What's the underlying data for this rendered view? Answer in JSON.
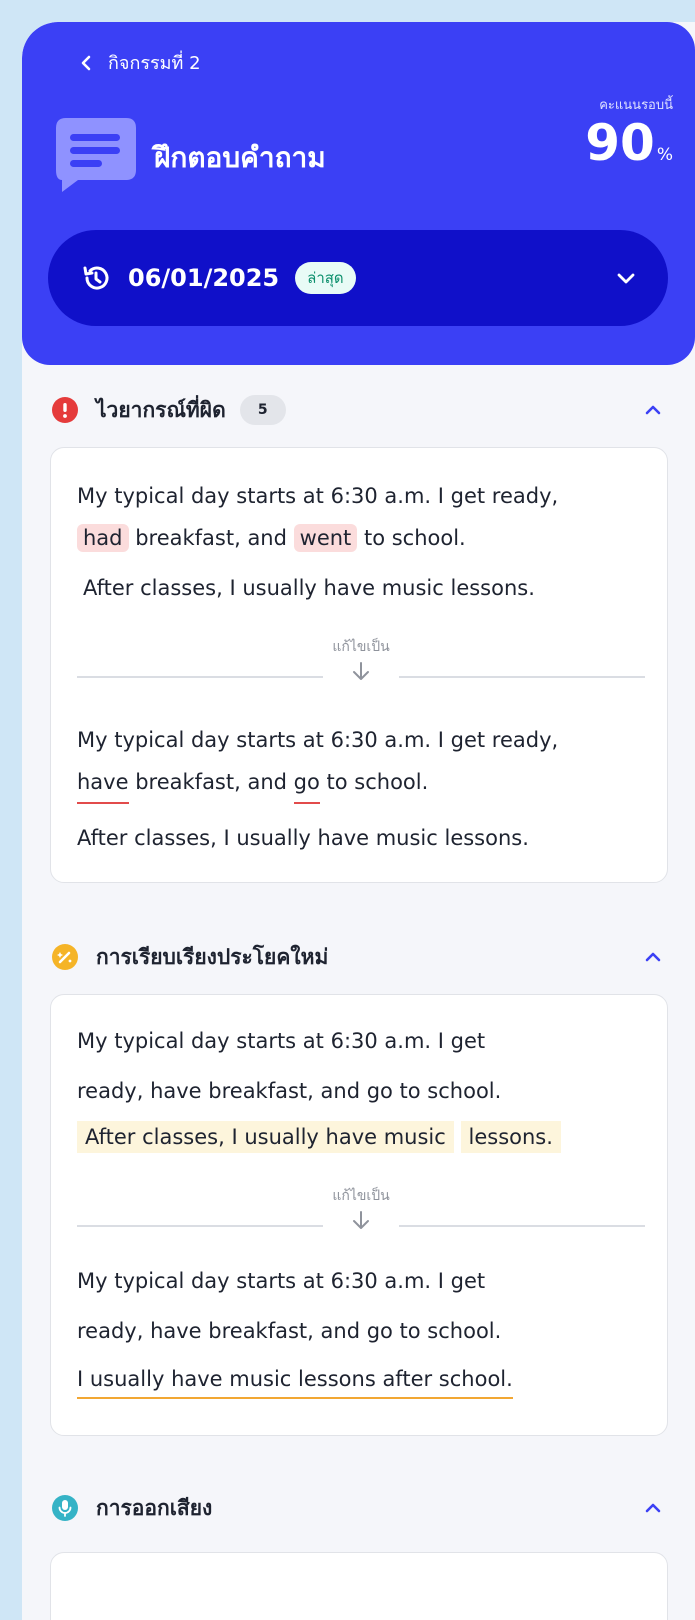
{
  "header": {
    "back_label": "กิจกรรมที่ 2",
    "title": "ฝึกตอบคำถาม",
    "score_label": "คะแนนรอบนี้",
    "score_value": "90",
    "score_unit": "%",
    "date": "06/01/2025",
    "latest_badge": "ล่าสุด"
  },
  "colors": {
    "header_bg": "#3b40f5",
    "date_bar_bg": "#1010c9",
    "grammar_icon": "#e53b3b",
    "rephrase_icon": "#f5b427",
    "pronunciation_icon": "#35b3c6",
    "accent_chevron": "#3b40f5"
  },
  "grammar": {
    "title": "ไวยากรณ์ที่ผิด",
    "count": "5",
    "icon": "exclamation-icon",
    "original": {
      "line1": "My typical day starts at 6:30 a.m. I get ready,",
      "err1": "had",
      "mid": "breakfast, and",
      "err2": "went",
      "end": "to school.",
      "line3": "After classes,  I usually have music lessons."
    },
    "divider": "แก้ไขเป็น",
    "corrected": {
      "line1": "My typical day starts at 6:30 a.m. I get ready,",
      "fix1": "have",
      "mid": "breakfast, and",
      "fix2": "go",
      "end": "to school.",
      "line3": "After classes, I usually have music lessons."
    }
  },
  "rephrase": {
    "title": "การเรียบเรียงประโยคใหม่",
    "icon": "magic-wand-icon",
    "original": {
      "line1": "My typical day starts at 6:30 a.m. I get",
      "line2": "ready, have breakfast, and go to school.",
      "hl1": "After classes, I usually have music",
      "hl2": "lessons."
    },
    "divider": "แก้ไขเป็น",
    "corrected": {
      "line1": "My typical day starts at 6:30 a.m. I get",
      "line2": "ready, have breakfast, and go to school.",
      "line3": "I usually have music lessons after school."
    }
  },
  "pronunciation": {
    "title": "การออกเสียง",
    "icon": "microphone-icon"
  }
}
